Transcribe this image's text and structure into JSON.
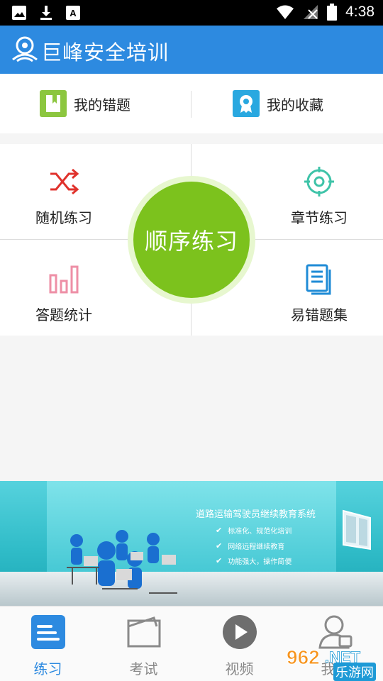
{
  "status_bar": {
    "time": "4:38"
  },
  "app_bar": {
    "title": "巨峰安全培训"
  },
  "quick": {
    "wrong_label": "我的错题",
    "favorites_label": "我的收藏"
  },
  "grid": {
    "random": "随机练习",
    "chapter": "章节练习",
    "sequential": "顺序练习",
    "stats": "答题统计",
    "error_prone": "易错题集"
  },
  "banner": {
    "title": "道路运输驾驶员继续教育系统",
    "items": [
      "标准化、规范化培训",
      "网络远程继续教育",
      "功能强大，操作简便"
    ]
  },
  "tabs": [
    {
      "label": "练习",
      "icon": "list-icon",
      "active": true
    },
    {
      "label": "考试",
      "icon": "folder-icon",
      "active": false
    },
    {
      "label": "视频",
      "icon": "play-icon",
      "active": false
    },
    {
      "label": "我的",
      "icon": "user-icon",
      "active": false
    }
  ],
  "watermark": {
    "text": "乐游网",
    "brand": "962.NET"
  },
  "colors": {
    "primary": "#2d8ae0",
    "green": "#7cc21d",
    "red": "#e0322c",
    "pink": "#ee8fa6",
    "teal": "#3ec3a8"
  }
}
